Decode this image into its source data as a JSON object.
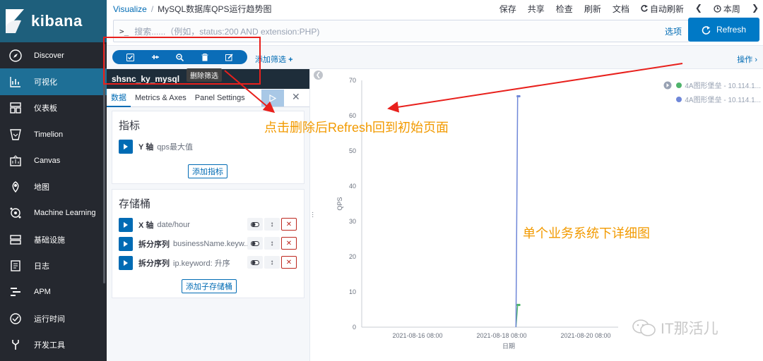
{
  "brand": {
    "title": "kibana"
  },
  "sidebar": {
    "items": [
      {
        "label": "Discover",
        "icon": "compass-icon"
      },
      {
        "label": "可视化",
        "icon": "visualize-icon"
      },
      {
        "label": "仪表板",
        "icon": "dashboard-icon"
      },
      {
        "label": "Timelion",
        "icon": "timelion-icon"
      },
      {
        "label": "Canvas",
        "icon": "canvas-icon"
      },
      {
        "label": "地图",
        "icon": "map-icon"
      },
      {
        "label": "Machine Learning",
        "icon": "ml-icon"
      },
      {
        "label": "基础设施",
        "icon": "infrastructure-icon"
      },
      {
        "label": "日志",
        "icon": "logs-icon"
      },
      {
        "label": "APM",
        "icon": "apm-icon"
      },
      {
        "label": "运行时间",
        "icon": "uptime-icon"
      },
      {
        "label": "开发工具",
        "icon": "devtools-icon"
      }
    ]
  },
  "breadcrumb": {
    "root": "Visualize",
    "separator": "/",
    "current": "MySQL数据库QPS运行趋势图"
  },
  "topmenu": {
    "save": "保存",
    "share": "共享",
    "inspect": "检查",
    "refresh": "刷新",
    "docs": "文档",
    "autorefresh": "自动刷新",
    "period": "本周"
  },
  "search": {
    "prompt": ">_",
    "placeholder": "搜索......（例如，status:200 AND extension:PHP)",
    "options": "选项"
  },
  "refresh_button": {
    "label": "Refresh"
  },
  "filterbar": {
    "add_filter": "添加筛选",
    "actions": "操作",
    "tooltip": "删除筛选"
  },
  "editor": {
    "index_title": "shsnc_ky_mysql",
    "tabs": [
      "数据",
      "Metrics & Axes",
      "Panel Settings"
    ],
    "metrics": {
      "title": "指标",
      "rows": [
        {
          "label": "Y 轴",
          "value": "qps最大值"
        }
      ],
      "add_button": "添加指标"
    },
    "buckets": {
      "title": "存储桶",
      "rows": [
        {
          "label": "X 轴",
          "value": "date/hour"
        },
        {
          "label": "拆分序列",
          "value": "businessName.keyw..."
        },
        {
          "label": "拆分序列",
          "value": "ip.keyword: 升序"
        }
      ],
      "add_button": "添加子存储桶"
    }
  },
  "chart_data": {
    "type": "line",
    "xlabel": "日期",
    "ylabel": "QPS",
    "ylim": [
      0,
      70
    ],
    "yticks": [
      0,
      10,
      20,
      30,
      40,
      50,
      60,
      70
    ],
    "xticks": [
      "2021-08-16 08:00",
      "2021-08-18 08:00",
      "2021-08-20 08:00"
    ],
    "series": [
      {
        "name": "4A图形堡垒 - 10.114.1...",
        "color": "#4fb36b",
        "x": [
          2.56,
          2.6,
          2.64
        ],
        "values": [
          0,
          6.3,
          6.3
        ]
      },
      {
        "name": "4A图形堡垒 - 10.114.1...",
        "color": "#6f87d8",
        "x": [
          2.56,
          2.6,
          2.64
        ],
        "values": [
          0,
          65.5,
          65.5
        ]
      }
    ]
  },
  "annotations": {
    "top": "点击删除后Refresh回到初始页面",
    "middle": "单个业务系统下详细图"
  },
  "watermark": {
    "text": "IT那活儿"
  }
}
